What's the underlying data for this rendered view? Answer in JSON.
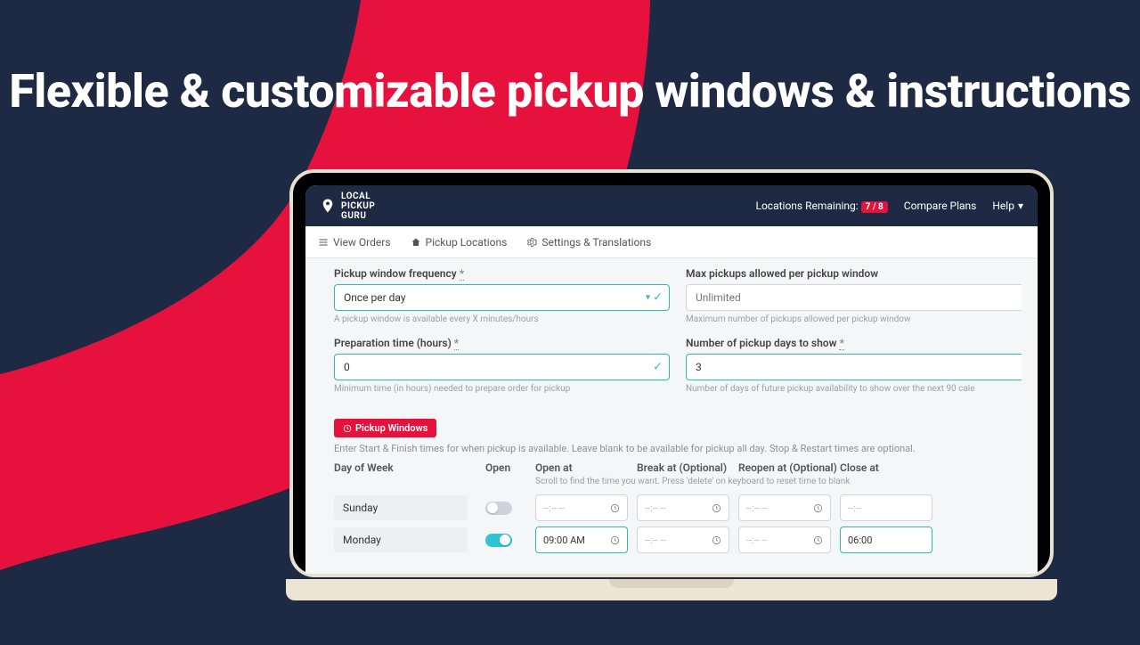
{
  "hero": "Flexible & customizable pickup windows & instructions",
  "brand": {
    "line1": "LOCAL",
    "line2": "PICKUP",
    "line3": "GURU"
  },
  "header": {
    "locations_label": "Locations Remaining:",
    "locations_badge": "7 / 8",
    "compare": "Compare Plans",
    "help": "Help"
  },
  "tabs": {
    "orders": "View Orders",
    "locations": "Pickup Locations",
    "settings": "Settings & Translations"
  },
  "form": {
    "freq_label": "Pickup window frequency",
    "freq_value": "Once per day",
    "freq_hint": "A pickup window is available every X minutes/hours",
    "max_label": "Max pickups allowed per pickup window",
    "max_placeholder": "Unlimited",
    "max_hint": "Maximum number of pickups allowed per pickup window",
    "prep_label": "Preparation time (hours)",
    "prep_value": "0",
    "prep_hint": "Minimum time (in hours) needed to prepare order for pickup",
    "days_label": "Number of pickup days to show",
    "days_value": "3",
    "days_hint": "Number of days of future pickup availability to show over the next 90 cale",
    "asterisk": "*"
  },
  "pw": {
    "badge": "Pickup Windows",
    "desc": "Enter Start & Finish times for when pickup is available. Leave blank to be available for pickup all day. Stop & Restart times are optional.",
    "cols": {
      "day": "Day of Week",
      "open": "Open",
      "open_at": "Open at",
      "break_at": "Break at (Optional)",
      "reopen_at": "Reopen at (Optional)",
      "close_at": "Close at"
    },
    "subhint": "Scroll to find the time you want. Press 'delete' on keyboard to reset time to blank",
    "rows": [
      {
        "day": "Sunday",
        "open": false,
        "open_at": "--:-- --",
        "break_at": "--:-- --",
        "reopen_at": "--:-- --",
        "close_at": "--:--"
      },
      {
        "day": "Monday",
        "open": true,
        "open_at": "09:00 AM",
        "break_at": "--:-- --",
        "reopen_at": "--:-- --",
        "close_at": "06:00"
      }
    ]
  }
}
